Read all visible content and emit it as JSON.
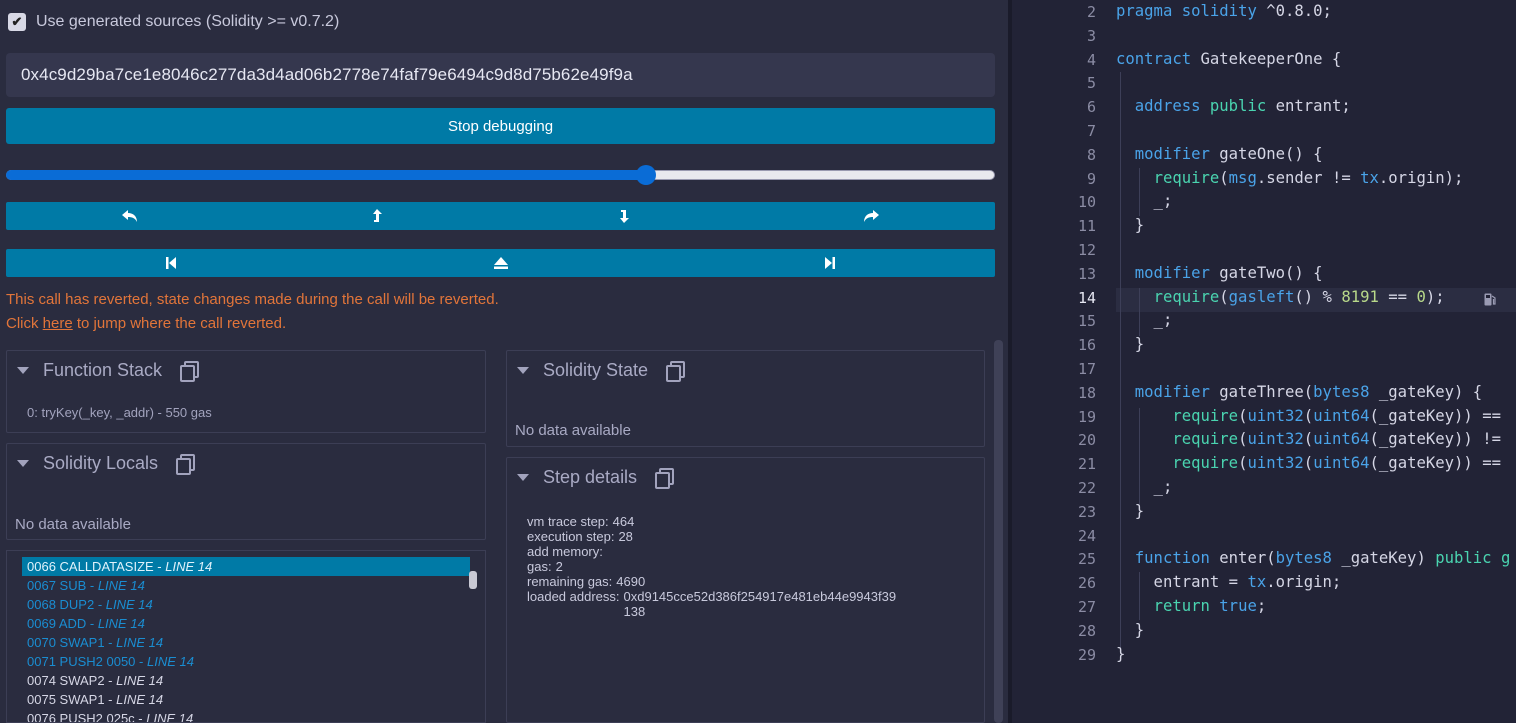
{
  "debugger": {
    "use_generated_sources": "Use generated sources (Solidity >= v0.7.2)",
    "tx_hash": "0x4c9d29ba7ce1e8046c277da3d4ad06b2778e74faf79e6494c9d8d75b62e49f9a",
    "stop_button": "Stop debugging",
    "slider_fraction": 0.65,
    "revert_line1": "This call has reverted, state changes made during the call will be reverted.",
    "revert_click": "Click ",
    "revert_here": "here",
    "revert_rest": " to jump where the call reverted."
  },
  "panels": {
    "function_stack": {
      "title": "Function Stack",
      "item": "0: tryKey(_key, _addr) - 550 gas"
    },
    "solidity_locals": {
      "title": "Solidity Locals",
      "empty": "No data available"
    },
    "solidity_state": {
      "title": "Solidity State",
      "empty": "No data available"
    },
    "step_details": {
      "title": "Step details",
      "rows": [
        {
          "k": "vm trace step:",
          "v": "464"
        },
        {
          "k": "execution step:",
          "v": "28"
        },
        {
          "k": "add memory:",
          "v": ""
        },
        {
          "k": "gas:",
          "v": "2"
        },
        {
          "k": "remaining gas:",
          "v": "4690"
        },
        {
          "k": "loaded address:",
          "v": "0xd9145cce52d386f254917e481eb44e9943f39\n138"
        }
      ]
    }
  },
  "opcodes": [
    {
      "op": "0066 CALLDATASIZE",
      "line": "LINE 14",
      "style": "sel"
    },
    {
      "op": "0067 SUB",
      "line": "LINE 14",
      "style": "blue"
    },
    {
      "op": "0068 DUP2",
      "line": "LINE 14",
      "style": "blue"
    },
    {
      "op": "0069 ADD",
      "line": "LINE 14",
      "style": "blue"
    },
    {
      "op": "0070 SWAP1",
      "line": "LINE 14",
      "style": "blue"
    },
    {
      "op": "0071 PUSH2 0050",
      "line": "LINE 14",
      "style": "blue"
    },
    {
      "op": "0074 SWAP2",
      "line": "LINE 14",
      "style": "white"
    },
    {
      "op": "0075 SWAP1",
      "line": "LINE 14",
      "style": "white"
    },
    {
      "op": "0076 PUSH2 025c",
      "line": "LINE 14",
      "style": "white"
    }
  ],
  "editor": {
    "active_line": "14",
    "lines": [
      {
        "n": "2",
        "html": "<span class='kw'>pragma</span> <span class='kw'>solidity</span> ^0.8.0;"
      },
      {
        "n": "3",
        "html": ""
      },
      {
        "n": "4",
        "html": "<span class='kw'>contract</span> GatekeeperOne {"
      },
      {
        "n": "5",
        "html": ""
      },
      {
        "n": "6",
        "html": "  <span class='kw'>address</span> <span class='kw2'>public</span> entrant;"
      },
      {
        "n": "7",
        "html": ""
      },
      {
        "n": "8",
        "html": "  <span class='kw'>modifier</span> gateOne() {"
      },
      {
        "n": "9",
        "html": "    <span class='kw2'>require</span>(<span class='fn'>msg</span>.sender != <span class='fn'>tx</span>.origin);"
      },
      {
        "n": "10",
        "html": "    _;"
      },
      {
        "n": "11",
        "html": "  }"
      },
      {
        "n": "12",
        "html": ""
      },
      {
        "n": "13",
        "html": "  <span class='kw'>modifier</span> gateTwo() {"
      },
      {
        "n": "14",
        "html": "    <span class='kw2'>require</span>(<span class='fn'>gasleft</span>() % <span class='num'>8191</span> == <span class='num'>0</span>);"
      },
      {
        "n": "15",
        "html": "    _;"
      },
      {
        "n": "16",
        "html": "  }"
      },
      {
        "n": "17",
        "html": ""
      },
      {
        "n": "18",
        "html": "  <span class='kw'>modifier</span> gateThree(<span class='kw'>bytes8</span> _gateKey) {"
      },
      {
        "n": "19",
        "html": "      <span class='kw2'>require</span>(<span class='kw'>uint32</span>(<span class='kw'>uint64</span>(_gateKey)) =="
      },
      {
        "n": "20",
        "html": "      <span class='kw2'>require</span>(<span class='kw'>uint32</span>(<span class='kw'>uint64</span>(_gateKey)) !="
      },
      {
        "n": "21",
        "html": "      <span class='kw2'>require</span>(<span class='kw'>uint32</span>(<span class='kw'>uint64</span>(_gateKey)) =="
      },
      {
        "n": "22",
        "html": "    _;"
      },
      {
        "n": "23",
        "html": "  }"
      },
      {
        "n": "24",
        "html": ""
      },
      {
        "n": "25",
        "html": "  <span class='kw'>function</span> enter(<span class='kw'>bytes8</span> _gateKey) <span class='kw2'>public</span> <span class='kw2'>g</span>"
      },
      {
        "n": "26",
        "html": "    entrant = <span class='fn'>tx</span>.origin;"
      },
      {
        "n": "27",
        "html": "    <span class='kw2'>return</span> <span class='kw'>true</span>;"
      },
      {
        "n": "28",
        "html": "  }"
      },
      {
        "n": "29",
        "html": "}"
      }
    ]
  },
  "colors": {
    "accent": "#007aa6",
    "background": "#2a2c3f",
    "error": "#e2753a"
  }
}
